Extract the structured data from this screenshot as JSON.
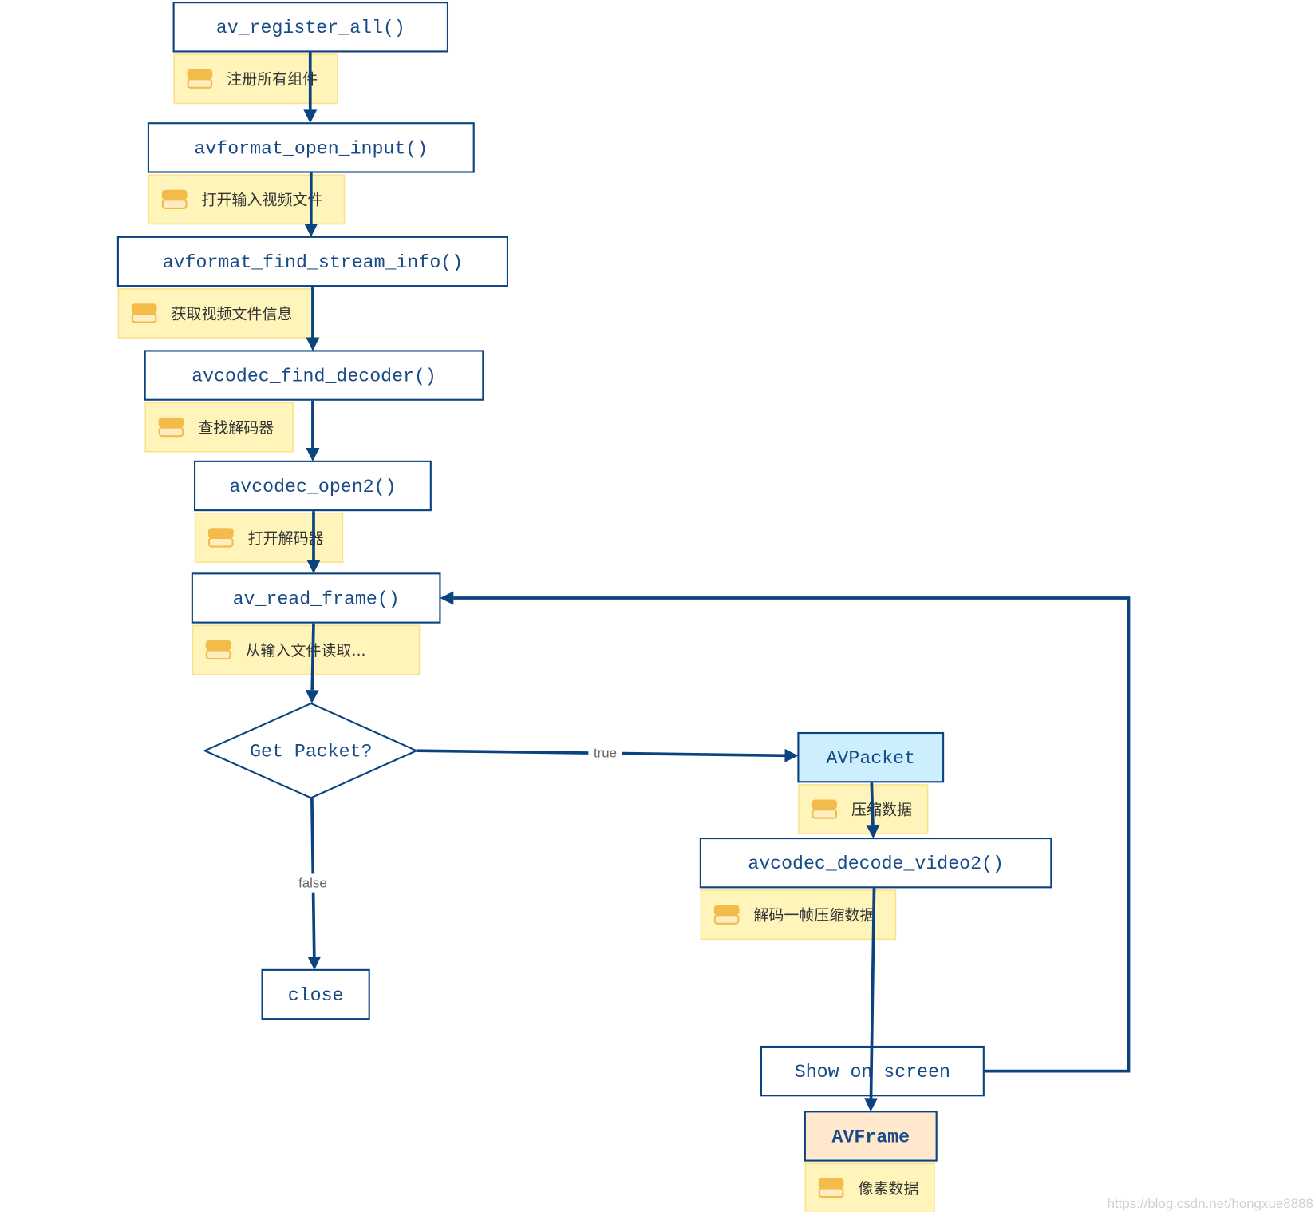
{
  "colors": {
    "stroke": "#0b4280",
    "note_fill": "#fff5bb",
    "note_border": "#fbe28a",
    "packet_fill": "#cdeffd",
    "frame_fill": "#ffe8cc",
    "icon": "#f3bc4a"
  },
  "nodes": [
    {
      "id": "av_register_all",
      "label": "av_register_all()",
      "note": "注册所有组件"
    },
    {
      "id": "avformat_open_input",
      "label": "avformat_open_input()",
      "note": "打开输入视频文件"
    },
    {
      "id": "avformat_find_stream_info",
      "label": "avformat_find_stream_info()",
      "note": "获取视频文件信息"
    },
    {
      "id": "avcodec_find_decoder",
      "label": "avcodec_find_decoder()",
      "note": "查找解码器"
    },
    {
      "id": "avcodec_open2",
      "label": "avcodec_open2()",
      "note": "打开解码器"
    },
    {
      "id": "av_read_frame",
      "label": "av_read_frame()",
      "note": "从输入文件读取..."
    },
    {
      "id": "get_packet",
      "label": "Get Packet?",
      "shape": "diamond"
    },
    {
      "id": "close",
      "label": "close"
    },
    {
      "id": "avpacket",
      "label": "AVPacket",
      "note": "压缩数据"
    },
    {
      "id": "avcodec_decode_video2",
      "label": "avcodec_decode_video2()",
      "note": "解码一帧压缩数据"
    },
    {
      "id": "show_on_screen",
      "label": "Show on screen"
    },
    {
      "id": "avframe",
      "label": "AVFrame",
      "note": "像素数据"
    }
  ],
  "edges": [
    {
      "from": "av_register_all",
      "to": "avformat_open_input"
    },
    {
      "from": "avformat_open_input",
      "to": "avformat_find_stream_info"
    },
    {
      "from": "avformat_find_stream_info",
      "to": "avcodec_find_decoder"
    },
    {
      "from": "avcodec_find_decoder",
      "to": "avcodec_open2"
    },
    {
      "from": "avcodec_open2",
      "to": "av_read_frame"
    },
    {
      "from": "av_read_frame",
      "to": "get_packet"
    },
    {
      "from": "get_packet",
      "to": "avpacket",
      "label": "true"
    },
    {
      "from": "get_packet",
      "to": "close",
      "label": "false"
    },
    {
      "from": "avpacket",
      "to": "avcodec_decode_video2"
    },
    {
      "from": "avcodec_decode_video2",
      "to": "avframe"
    },
    {
      "from": "show_on_screen",
      "to": "av_read_frame"
    }
  ],
  "watermark": "https://blog.csdn.net/hongxue8888"
}
